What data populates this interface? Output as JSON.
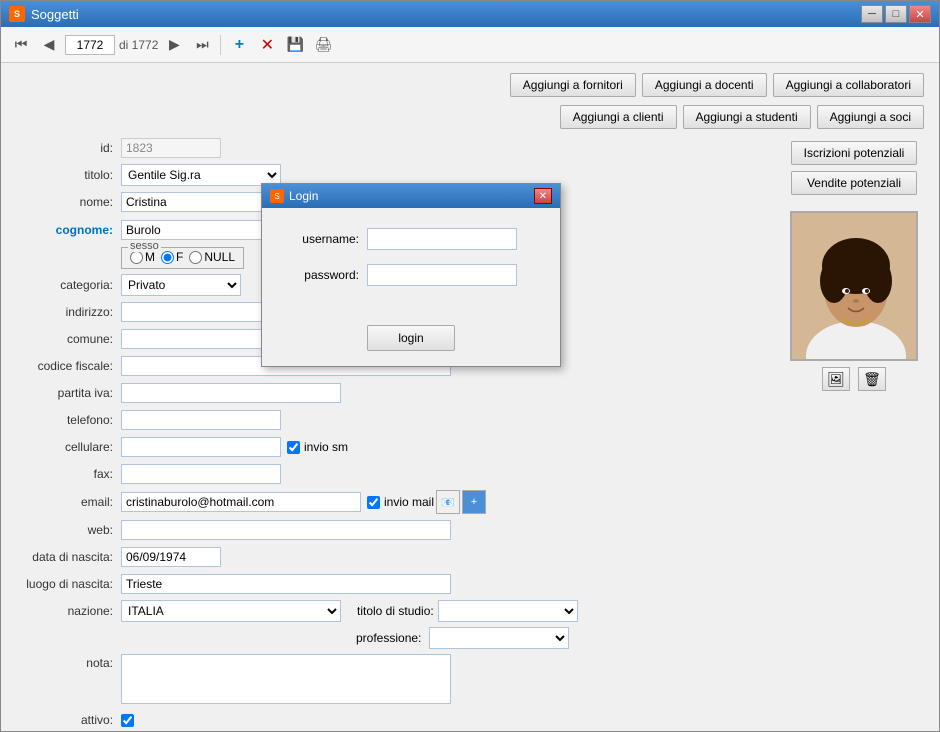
{
  "window": {
    "title": "Soggetti",
    "icon": "S"
  },
  "toolbar": {
    "nav_current": "1772",
    "nav_of": "di 1772",
    "first_btn": "⏮",
    "prev_btn": "◀",
    "next_btn": "▶",
    "last_btn": "⏭",
    "add_btn": "+",
    "delete_btn": "✕",
    "save_btn": "💾",
    "print_btn": "🖨"
  },
  "top_buttons": {
    "fornitori": "Aggiungi a fornitori",
    "docenti": "Aggiungi a docenti",
    "collaboratori": "Aggiungi a collaboratori",
    "clienti": "Aggiungi a clienti",
    "studenti": "Aggiungi a studenti",
    "soci": "Aggiungi a soci",
    "iscrizioni": "Iscrizioni potenziali",
    "vendite": "Vendite potenziali"
  },
  "form": {
    "id_label": "id:",
    "id_value": "1823",
    "titolo_label": "titolo:",
    "titolo_value": "Gentile Sig.ra",
    "nome_label": "nome:",
    "nome_value": "Cristina",
    "cognome_label": "cognome:",
    "cognome_value": "Burolo",
    "sesso_label": "sesso",
    "sesso_m": "M",
    "sesso_f": "F",
    "sesso_null": "NULL",
    "sesso_selected": "F",
    "categoria_label": "categoria:",
    "categoria_value": "Privato",
    "indirizzo_label": "indirizzo:",
    "indirizzo_value": "",
    "comune_label": "comune:",
    "comune_value": "",
    "codice_fiscale_label": "codice fiscale:",
    "codice_fiscale_value": "",
    "partita_iva_label": "partita iva:",
    "partita_iva_value": "",
    "telefono_label": "telefono:",
    "telefono_value": "",
    "cellulare_label": "cellulare:",
    "cellulare_value": "",
    "invio_sms_label": "invio sm",
    "fax_label": "fax:",
    "fax_value": "",
    "email_label": "email:",
    "email_value": "cristinaburolo@hotmail.com",
    "invio_mail_label": "invio mail",
    "web_label": "web:",
    "web_value": "",
    "data_nascita_label": "data di nascita:",
    "data_nascita_value": "06/09/1974",
    "luogo_nascita_label": "luogo di nascita:",
    "luogo_nascita_value": "Trieste",
    "nazione_label": "nazione:",
    "nazione_value": "ITALIA",
    "titolo_studio_label": "titolo di studio:",
    "titolo_studio_value": "",
    "professione_label": "professione:",
    "professione_value": "",
    "nota_label": "nota:",
    "nota_value": "",
    "attivo_label": "attivo:"
  },
  "login_dialog": {
    "title": "Login",
    "username_label": "username:",
    "password_label": "password:",
    "login_btn": "login",
    "username_value": "",
    "password_value": ""
  },
  "photo": {
    "add_label": "🖼",
    "remove_label": "🖼"
  }
}
